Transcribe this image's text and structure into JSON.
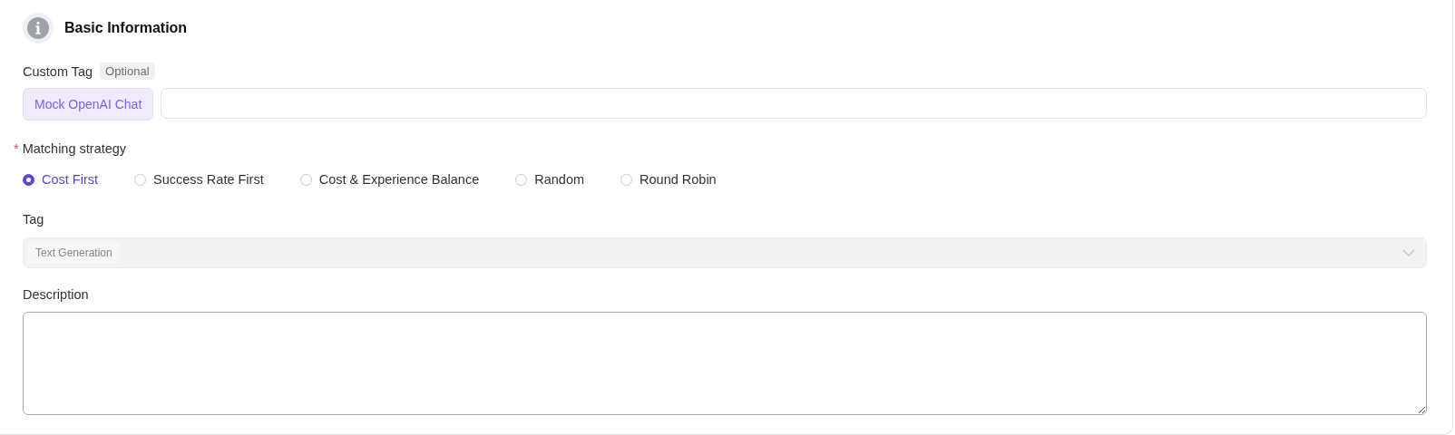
{
  "section": {
    "title": "Basic Information"
  },
  "custom_tag": {
    "label": "Custom Tag",
    "badge": "Optional",
    "prefix": "Mock OpenAI Chat"
  },
  "matching_strategy": {
    "label": "Matching strategy",
    "required": true,
    "required_mark": "*",
    "options": [
      {
        "label": "Cost First",
        "selected": true
      },
      {
        "label": "Success Rate First",
        "selected": false
      },
      {
        "label": "Cost & Experience Balance",
        "selected": false
      },
      {
        "label": "Random",
        "selected": false
      },
      {
        "label": "Round Robin",
        "selected": false
      }
    ]
  },
  "tag": {
    "label": "Tag",
    "disabled": true,
    "values": [
      "Text Generation"
    ]
  },
  "description": {
    "label": "Description"
  }
}
